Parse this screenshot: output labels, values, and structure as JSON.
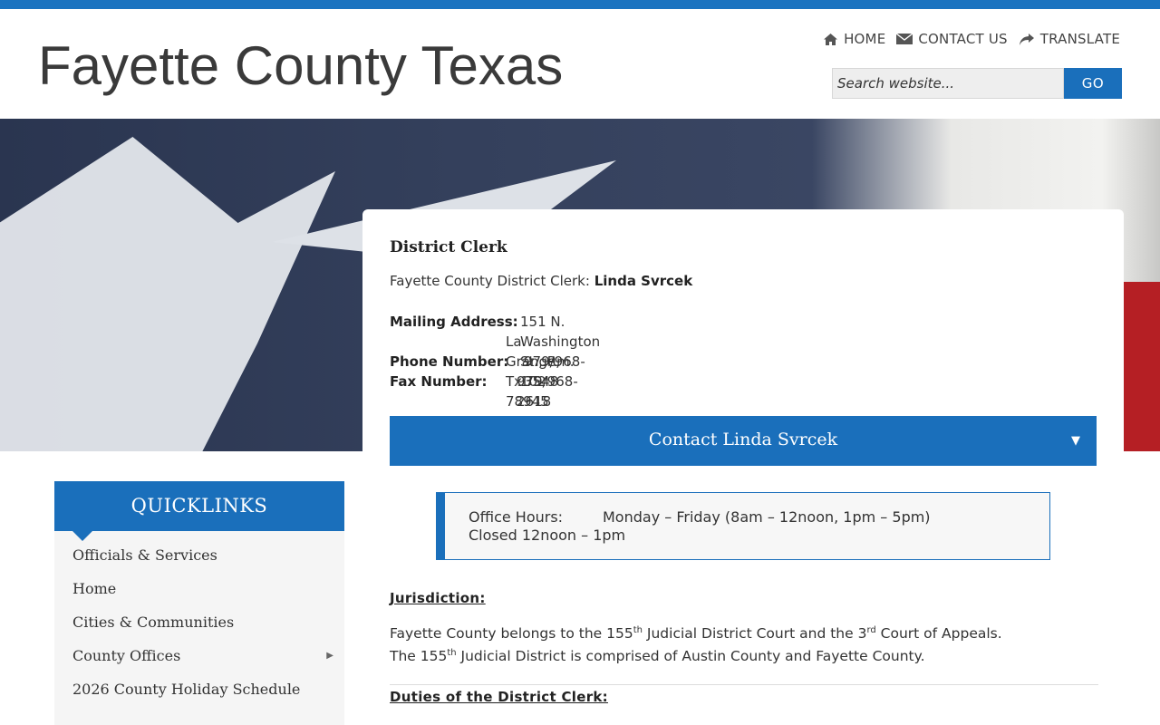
{
  "site": {
    "title": "Fayette County Texas"
  },
  "topnav": [
    {
      "icon": "home-icon",
      "label": "HOME"
    },
    {
      "icon": "envelope-icon",
      "label": "CONTACT US"
    },
    {
      "icon": "share-arrow-icon",
      "label": "TRANSLATE"
    }
  ],
  "search": {
    "placeholder": "Search website...",
    "button_label": "GO"
  },
  "card": {
    "title": "District Clerk",
    "clerk_prefix": "Fayette County District Clerk: ",
    "clerk_name": "Linda Svrcek",
    "mailing_label": "Mailing Address:",
    "mailing_line1": "151 N. Washington St., Rm. 102",
    "mailing_line2": "La Grange, Tx  78945",
    "phone_label": "Phone Number:",
    "phone_value": "979/968-3548",
    "fax_label": "Fax Number:",
    "fax_value": "979/968-2618",
    "contact_button": "Contact Linda Svrcek",
    "hours_label": "Office Hours:",
    "hours_value": "Monday – Friday (8am – 12noon, 1pm – 5pm)",
    "hours_closed": "Closed 12noon – 1pm",
    "jurisdiction_heading": "Jurisdiction:",
    "jurisdiction_line1_a": "Fayette County belongs to the 155",
    "jurisdiction_line1_sup1": "th",
    "jurisdiction_line1_b": " Judicial District Court and the 3",
    "jurisdiction_line1_sup2": "rd",
    "jurisdiction_line1_c": " Court of Appeals.",
    "jurisdiction_line2_a": "The 155",
    "jurisdiction_line2_sup": "th",
    "jurisdiction_line2_b": " Judicial District is comprised of Austin County and Fayette County.",
    "duties_heading": "Duties of the District Clerk:"
  },
  "quicklinks": {
    "heading": "QUICKLINKS",
    "items": [
      {
        "label": "Officials & Services",
        "has_submenu": false
      },
      {
        "label": "Home",
        "has_submenu": false
      },
      {
        "label": "Cities & Communities",
        "has_submenu": false
      },
      {
        "label": "County Offices",
        "has_submenu": true
      },
      {
        "label": "2026 County Holiday Schedule",
        "has_submenu": false
      }
    ]
  },
  "colors": {
    "brand_blue": "#1a6fbb",
    "topbar": "#1a73c0",
    "flag_red": "#b51f24"
  }
}
